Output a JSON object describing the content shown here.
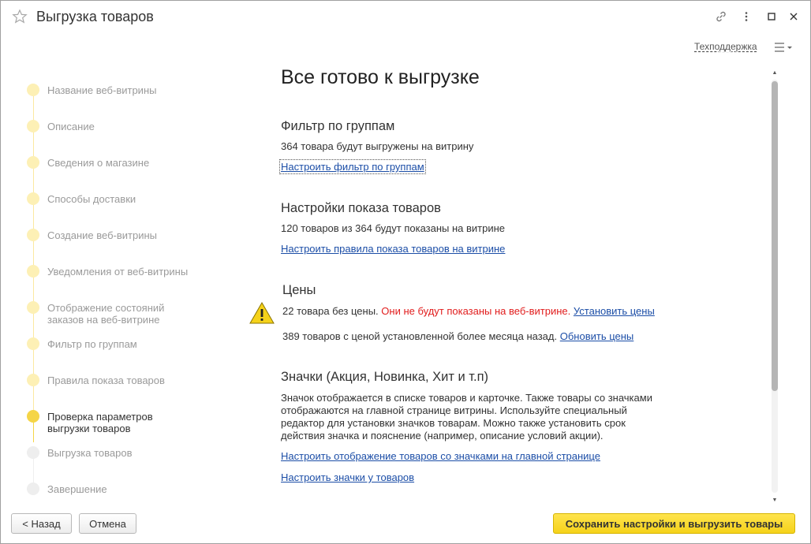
{
  "window": {
    "title": "Выгрузка товаров",
    "support_link": "Техподдержка"
  },
  "steps": [
    {
      "label": "Название веб-витрины",
      "state": "done"
    },
    {
      "label": "Описание",
      "state": "done"
    },
    {
      "label": "Сведения о магазине",
      "state": "done"
    },
    {
      "label": "Способы доставки",
      "state": "done"
    },
    {
      "label": "Создание веб-витрины",
      "state": "done"
    },
    {
      "label": "Уведомления от веб-витрины",
      "state": "done"
    },
    {
      "label": "Отображение состояний заказов на веб-витрине",
      "state": "done"
    },
    {
      "label": "Фильтр по группам",
      "state": "done"
    },
    {
      "label": "Правила показа товаров",
      "state": "done"
    },
    {
      "label": "Проверка параметров выгрузки товаров",
      "state": "current"
    },
    {
      "label": "Выгрузка товаров",
      "state": "future"
    },
    {
      "label": "Завершение",
      "state": "future"
    }
  ],
  "main": {
    "heading": "Все готово к выгрузке",
    "filter": {
      "title": "Фильтр по группам",
      "text": "364 товара будут выгружены на витрину",
      "link": "Настроить фильтр по группам"
    },
    "display": {
      "title": "Настройки показа товаров",
      "text": "120 товаров из 364 будут показаны на витрине",
      "link": "Настроить правила показа товаров на витрине"
    },
    "prices": {
      "title": "Цены",
      "no_price_text": "22 товара без цены.",
      "no_price_warning": "Они не будут показаны на веб-витрине.",
      "set_prices_link": "Установить цены",
      "old_price_text": "389 товаров с ценой установленной более месяца назад.",
      "update_prices_link": "Обновить цены"
    },
    "badges": {
      "title": "Значки (Акция, Новинка, Хит и т.п)",
      "lines": [
        "Значок отображается в списке товаров и карточке. Также товары со значками",
        "отображаются на главной странице витрины. Используйте специальный",
        "редактор для установки значков товарам. Можно также установить срок",
        "действия значка и пояснение (например, описание условий акции)."
      ],
      "link_main_page": "Настроить отображение товаров со значками на главной странице",
      "link_items": "Настроить значки у товаров"
    }
  },
  "buttons": {
    "back": "< Назад",
    "cancel": "Отмена",
    "save": "Сохранить настройки и выгрузить товары"
  },
  "colors": {
    "accent_yellow": "#f5d21a",
    "link_blue": "#1c4ea7",
    "warning_red": "#e11d1d",
    "step_done": "#fdf0b5",
    "step_current": "#f5d547"
  }
}
